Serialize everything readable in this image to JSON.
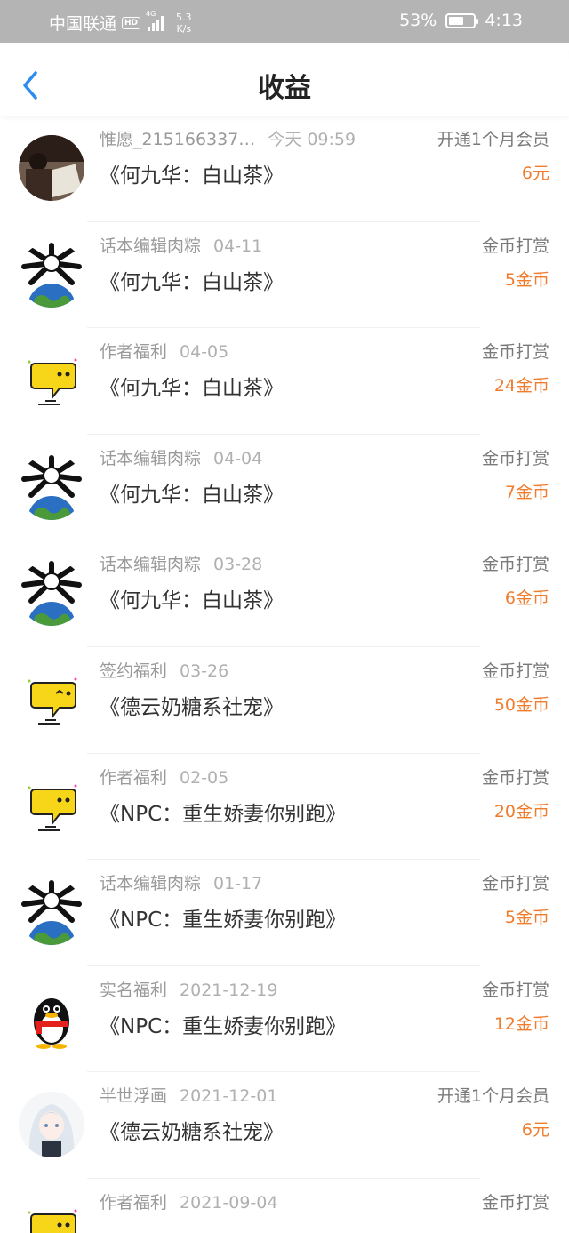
{
  "status_bar": {
    "carrier": "中国联通",
    "hd": "HD",
    "network": "4G",
    "speed_value": "5.3",
    "speed_unit": "K/s",
    "battery": "53%",
    "time": "4:13"
  },
  "header": {
    "title": "收益"
  },
  "colors": {
    "accent_blue": "#2d8cf0",
    "amount_orange": "#f07c2e"
  },
  "income": [
    {
      "avatar": "photo-avatar",
      "name": "惟愿_215166337…",
      "date": "今天 09:59",
      "book": "《何九华：白山茶》",
      "type": "开通1个月会员",
      "amount": "6元"
    },
    {
      "avatar": "spider-globe-avatar",
      "name": "话本编辑肉粽",
      "date": "04-11",
      "book": "《何九华：白山茶》",
      "type": "金币打赏",
      "amount": "5金币"
    },
    {
      "avatar": "chat-bubble-avatar",
      "name": "作者福利",
      "date": "04-05",
      "book": "《何九华：白山茶》",
      "type": "金币打赏",
      "amount": "24金币"
    },
    {
      "avatar": "spider-globe-avatar",
      "name": "话本编辑肉粽",
      "date": "04-04",
      "book": "《何九华：白山茶》",
      "type": "金币打赏",
      "amount": "7金币"
    },
    {
      "avatar": "spider-globe-avatar",
      "name": "话本编辑肉粽",
      "date": "03-28",
      "book": "《何九华：白山茶》",
      "type": "金币打赏",
      "amount": "6金币"
    },
    {
      "avatar": "chat-bubble-wink-avatar",
      "name": "签约福利",
      "date": "03-26",
      "book": "《德云奶糖系社宠》",
      "type": "金币打赏",
      "amount": "50金币"
    },
    {
      "avatar": "chat-bubble-avatar",
      "name": "作者福利",
      "date": "02-05",
      "book": "《NPC：重生娇妻你别跑》",
      "type": "金币打赏",
      "amount": "20金币"
    },
    {
      "avatar": "spider-globe-avatar",
      "name": "话本编辑肉粽",
      "date": "01-17",
      "book": "《NPC：重生娇妻你别跑》",
      "type": "金币打赏",
      "amount": "5金币"
    },
    {
      "avatar": "penguin-avatar",
      "name": "实名福利",
      "date": "2021-12-19",
      "book": "《NPC：重生娇妻你别跑》",
      "type": "金币打赏",
      "amount": "12金币"
    },
    {
      "avatar": "anime-girl-avatar",
      "name": "半世浮画",
      "date": "2021-12-01",
      "book": "《德云奶糖系社宠》",
      "type": "开通1个月会员",
      "amount": "6元"
    },
    {
      "avatar": "chat-bubble-avatar",
      "name": "作者福利",
      "date": "2021-09-04",
      "book": "",
      "type": "金币打赏",
      "amount": ""
    }
  ]
}
